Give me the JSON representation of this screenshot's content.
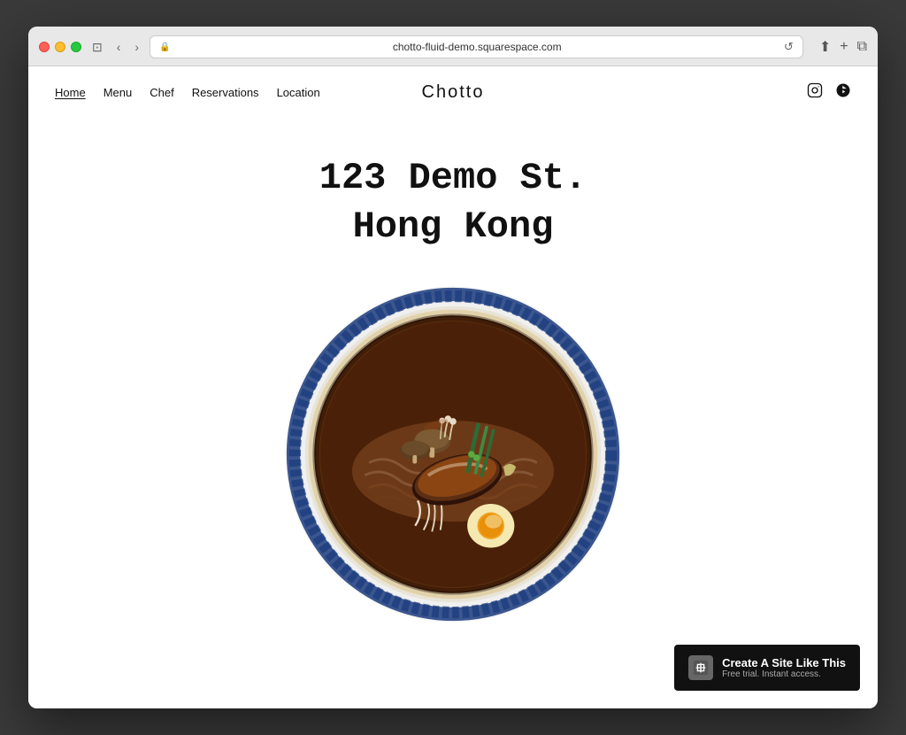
{
  "browser": {
    "url": "chotto-fluid-demo.squarespace.com",
    "reload_label": "↺",
    "back_label": "‹",
    "forward_label": "›",
    "share_label": "⬆",
    "add_tab_label": "+",
    "duplicate_label": "⧉",
    "sidebar_label": "⊞"
  },
  "nav": {
    "links": [
      {
        "label": "Home",
        "active": true
      },
      {
        "label": "Menu",
        "active": false
      },
      {
        "label": "Chef",
        "active": false
      },
      {
        "label": "Reservations",
        "active": false
      },
      {
        "label": "Location",
        "active": false
      }
    ],
    "logo": "Chotto",
    "social": [
      {
        "name": "instagram",
        "icon": "📷",
        "unicode": "⊕"
      },
      {
        "name": "yelp",
        "icon": "✿",
        "unicode": "✿"
      }
    ]
  },
  "hero": {
    "address_line1": "123 Demo St.",
    "address_line2": "Hong Kong"
  },
  "squarespace_banner": {
    "main_text": "Create A Site Like This",
    "sub_text": "Free trial. Instant access."
  }
}
